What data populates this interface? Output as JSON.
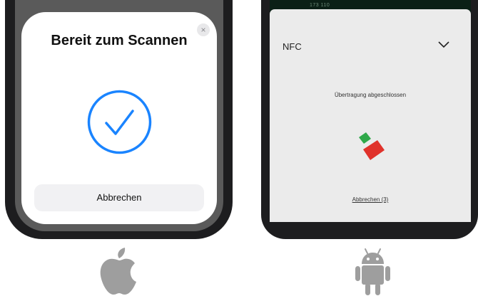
{
  "ios": {
    "title": "Bereit zum Scannen",
    "close_icon": "×",
    "cancel_label": "Abbrechen",
    "accent_color": "#1a84ff"
  },
  "android": {
    "status_left": "",
    "status_right": "173 110    ",
    "nfc_label": "NFC",
    "transfer_text": "Übertragung abgeschlossen",
    "cancel_label": "Abbrechen (3)",
    "icon_colors": {
      "green": "#2fa84a",
      "red": "#e0322b"
    }
  },
  "logos": {
    "apple": "apple-logo",
    "android": "android-logo"
  }
}
